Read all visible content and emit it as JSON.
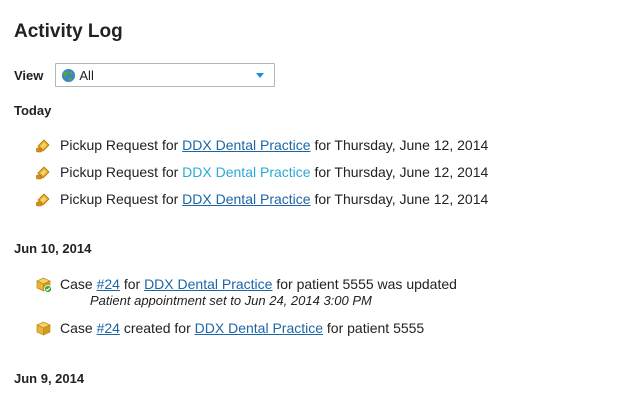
{
  "page": {
    "title": "Activity Log"
  },
  "filter": {
    "label": "View",
    "selected": "All",
    "icon": "globe-icon"
  },
  "groups": [
    {
      "title": "Today",
      "entries": [
        {
          "icon": "pickup-request-icon",
          "text_before": "Pickup Request for ",
          "link": "DDX Dental Practice",
          "text_after": " for Thursday, June 12, 2014"
        },
        {
          "icon": "pickup-request-icon",
          "text_before": "Pickup Request for ",
          "link": "DDX Dental Practice",
          "text_after": " for Thursday, June 12, 2014"
        },
        {
          "icon": "pickup-request-icon",
          "text_before": "Pickup Request for ",
          "link": "DDX Dental Practice",
          "text_after": " for Thursday, June 12, 2014"
        }
      ]
    },
    {
      "title": "Jun 10, 2014",
      "entries": [
        {
          "icon": "case-updated-icon",
          "text_before": "Case ",
          "case_link": "#24",
          "text_mid": " for ",
          "link": "DDX Dental Practice",
          "text_after": " for patient 5555 was updated",
          "detail": "Patient appointment set to Jun 24, 2014 3:00 PM"
        },
        {
          "icon": "case-created-icon",
          "text_before": "Case ",
          "case_link": "#24",
          "text_mid": " created for ",
          "link": "DDX Dental Practice",
          "text_after": " for patient 5555"
        }
      ]
    },
    {
      "title": "Jun 9, 2014"
    }
  ],
  "colors": {
    "link": "#1d66a6",
    "link_hover": "#2aa9d7",
    "accent": "#1a8fd2",
    "pickup_icon": "#e8a317",
    "case_icon": "#f0c040",
    "case_updated_badge": "#3aa53a"
  }
}
